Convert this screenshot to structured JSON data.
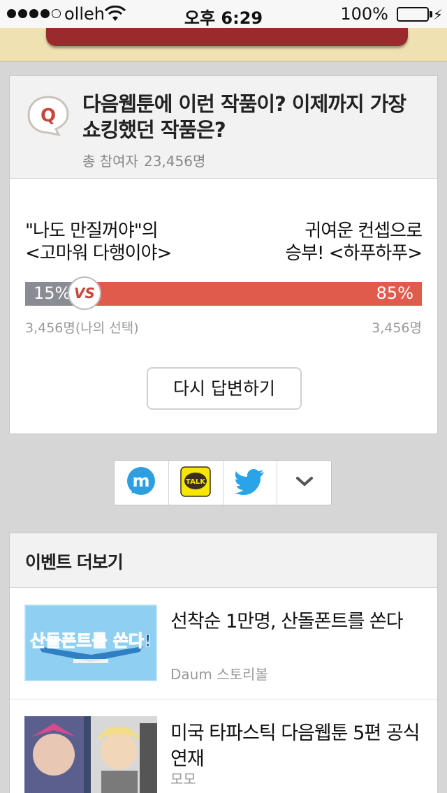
{
  "status_bar": {
    "carrier": "olleh",
    "time": "오후 6:29",
    "battery_percent": "100%",
    "battery_level": 1.0,
    "signal_bars": 4,
    "signal_max": 5
  },
  "poll": {
    "badge_letter": "Q",
    "question": "다음웹툰에 이런 작품이? 이제까지 가장 쇼킹했던 작품은?",
    "participants_label": "총 참여자",
    "participants_count": "23,456명",
    "option_left": {
      "line1": "\"나도 만질꺼야\"의",
      "line2": "<고마워 다행이야>",
      "percent_label": "15%",
      "percent": 15,
      "votes": "3,456명(나의 선택)"
    },
    "option_right": {
      "line1": "귀여운 컨셉으로",
      "line2": "승부! <하푸하푸>",
      "percent_label": "85%",
      "percent": 85,
      "votes": "3,456명"
    },
    "vs_label": "VS",
    "reanswer_label": "다시 답변하기"
  },
  "share": {
    "buttons": [
      "mypeople-icon",
      "kakaotalk-icon",
      "twitter-icon",
      "chevron-down-icon"
    ],
    "kakao_text": "TALK"
  },
  "events": {
    "header": "이벤트 더보기",
    "items": [
      {
        "title": "선착순 1만명, 산돌폰트를 쏜다",
        "source": "Daum 스토리볼",
        "thumb_text": "산돌폰트를 쏜다!"
      },
      {
        "title": "미국 타파스틱 다음웹툰 5편 공식 연재",
        "source": "모모"
      }
    ]
  },
  "colors": {
    "accent_red": "#e15b4c",
    "bar_gray": "#8a8c93",
    "banner_red": "#9b2a2c",
    "banner_bg": "#efe1b1",
    "battery_green": "#4cd964"
  }
}
